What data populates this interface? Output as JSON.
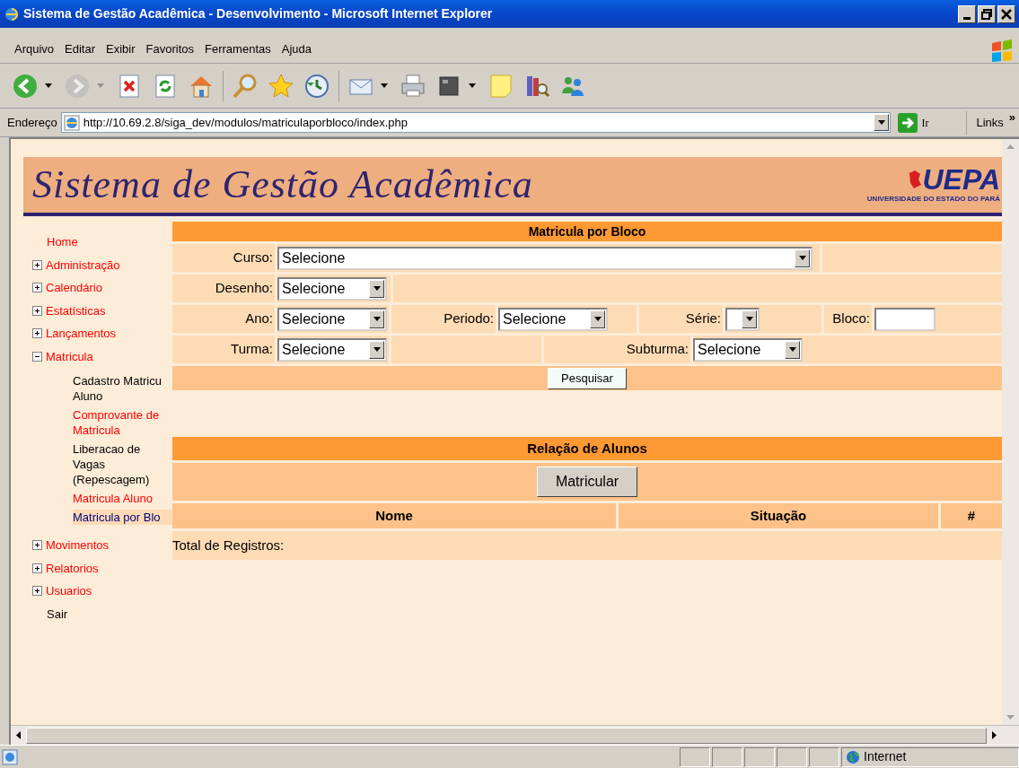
{
  "window": {
    "title": "Sistema de Gestão Acadêmica - Desenvolvimento - Microsoft Internet Explorer"
  },
  "menu": [
    "Arquivo",
    "Editar",
    "Exibir",
    "Favoritos",
    "Ferramentas",
    "Ajuda"
  ],
  "toolbar": [
    {
      "kind": "back",
      "dropdown": true,
      "disabled": false
    },
    {
      "kind": "forward",
      "dropdown": true,
      "disabled": true
    },
    {
      "kind": "stop",
      "dropdown": false,
      "disabled": false
    },
    {
      "kind": "refresh",
      "dropdown": false,
      "disabled": false
    },
    {
      "kind": "home",
      "dropdown": false,
      "disabled": false
    },
    {
      "kind": "search",
      "dropdown": false,
      "disabled": false
    },
    {
      "kind": "favorites",
      "dropdown": false,
      "disabled": false
    },
    {
      "kind": "history",
      "dropdown": false,
      "disabled": false
    },
    {
      "kind": "mail",
      "dropdown": true,
      "disabled": false
    },
    {
      "kind": "print",
      "dropdown": false,
      "disabled": false
    },
    {
      "kind": "edit",
      "dropdown": true,
      "disabled": false
    },
    {
      "kind": "note",
      "dropdown": false,
      "disabled": false
    },
    {
      "kind": "research",
      "dropdown": false,
      "disabled": false
    },
    {
      "kind": "messenger",
      "dropdown": false,
      "disabled": false
    }
  ],
  "address": {
    "label": "Endereço",
    "url": "http://10.69.2.8/siga_dev/modulos/matriculaporbloco/index.php",
    "go": "Ir",
    "links": "Links",
    "more": "»"
  },
  "banner": {
    "title": "Sistema de Gestão Acadêmica",
    "logo": "UEPA",
    "logo_subtitle": "UNIVERSIDADE DO ESTADO DO PARÁ"
  },
  "sidebar": {
    "items": [
      {
        "label": "Home",
        "color": "#ff0000"
      },
      {
        "label": "Administração",
        "color": "#ff0000",
        "expanded": false
      },
      {
        "label": "Calendário",
        "color": "#ff0000",
        "expanded": false
      },
      {
        "label": "Estatísticas",
        "color": "#ff0000",
        "expanded": false
      },
      {
        "label": "Lançamentos",
        "color": "#ff0000",
        "expanded": false
      },
      {
        "label": "Matricula",
        "color": "#ff0000",
        "expanded": true,
        "children": [
          {
            "label": "Cadastro Matricu\nAluno",
            "color": "#000000",
            "selected": false
          },
          {
            "label": "Comprovante de\nMatricula",
            "color": "#ff0000",
            "selected": false
          },
          {
            "label": "Liberacao de\nVagas\n(Repescagem)",
            "color": "#000000",
            "selected": false
          },
          {
            "label": "Matricula Aluno",
            "color": "#ff0000",
            "selected": false
          },
          {
            "label": "Matricula por Blo",
            "color": "#000080",
            "selected": true
          }
        ]
      },
      {
        "label": "Movimentos",
        "color": "#ff0000",
        "expanded": false
      },
      {
        "label": "Relatorios",
        "color": "#ff0000",
        "expanded": false
      },
      {
        "label": "Usuarios",
        "color": "#ff0000",
        "expanded": false
      },
      {
        "label": "Sair",
        "color": "#000000"
      }
    ]
  },
  "search_form": {
    "title": "Matricula por Bloco",
    "rows": [
      [
        {
          "label": "Curso:",
          "kind": "select",
          "value": "Selecione"
        }
      ],
      [
        {
          "label": "Desenho:",
          "kind": "select",
          "value": "Selecione"
        }
      ],
      [
        {
          "label": "Ano:",
          "kind": "select",
          "value": "Selecione"
        },
        {
          "label": "Periodo:",
          "kind": "select",
          "value": "Selecione"
        },
        {
          "label": "Série:",
          "kind": "select"
        },
        {
          "label": "Bloco:",
          "kind": "text"
        }
      ],
      [
        {
          "label": "Turma:",
          "kind": "select",
          "value": "Selecione"
        },
        "",
        {
          "label": "Subturma:",
          "kind": "select",
          "value": "Selecione"
        }
      ]
    ],
    "button": "Pesquisar"
  },
  "results": {
    "title": "Relação de Alunos",
    "button": "Matricular",
    "columns": [
      "Nome",
      "Situação",
      "#"
    ],
    "total_label": "Total de Registros:"
  },
  "status_bar": {
    "zone": "Internet"
  }
}
